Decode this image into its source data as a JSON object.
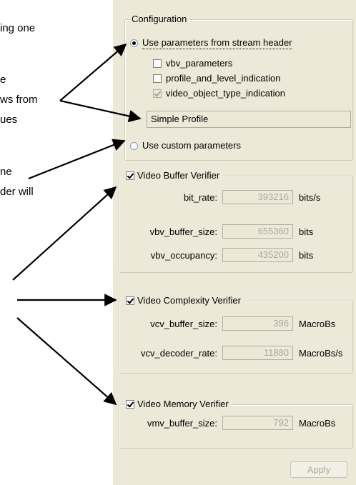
{
  "doc_fragments": [
    "ing one",
    "e",
    "ws from",
    "ues",
    "ne",
    "der will"
  ],
  "config": {
    "title": "Configuration",
    "use_stream_header": "Use parameters from stream header",
    "vbv_parameters": "vbv_parameters",
    "profile_and_level": "profile_and_level_indication",
    "video_object_type": "video_object_type_indication",
    "profile_value": "Simple Profile",
    "use_custom": "Use custom parameters"
  },
  "vbv": {
    "title": "Video Buffer Verifier",
    "rows": [
      {
        "label": "bit_rate:",
        "value": "393216",
        "unit": "bits/s"
      },
      {
        "label": "vbv_buffer_size:",
        "value": "655360",
        "unit": "bits"
      },
      {
        "label": "vbv_occupancy:",
        "value": "435200",
        "unit": "bits"
      }
    ]
  },
  "vcv": {
    "title": "Video Complexity Verifier",
    "rows": [
      {
        "label": "vcv_buffer_size:",
        "value": "396",
        "unit": "MacroBs"
      },
      {
        "label": "vcv_decoder_rate:",
        "value": "11880",
        "unit": "MacroBs/s"
      }
    ]
  },
  "vmv": {
    "title": "Video Memory Verifier",
    "rows": [
      {
        "label": "vmv_buffer_size:",
        "value": "792",
        "unit": "MacroBs"
      }
    ]
  },
  "apply_label": "Apply"
}
